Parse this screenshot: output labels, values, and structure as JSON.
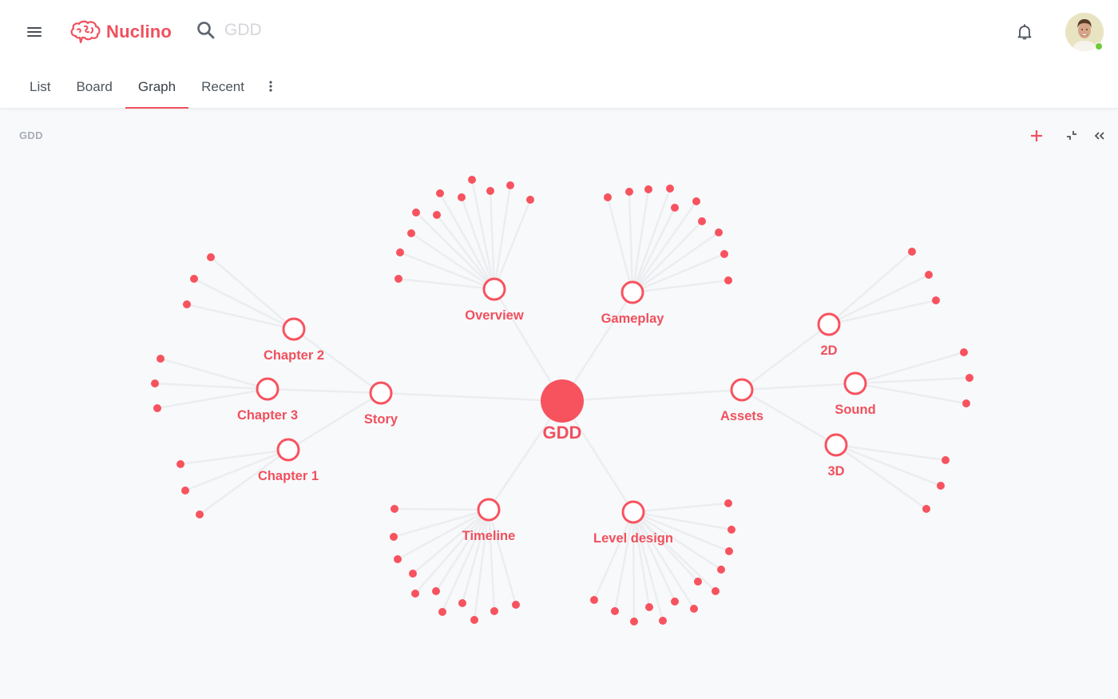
{
  "app": {
    "name": "Nuclino",
    "brand_color": "#f0505d"
  },
  "header": {
    "menu_icon": "hamburger-icon",
    "search_icon": "search-icon",
    "search_value": "GDD",
    "notifications_icon": "bell-icon",
    "user_status": "online"
  },
  "tabs": [
    {
      "label": "List",
      "active": false
    },
    {
      "label": "Board",
      "active": false
    },
    {
      "label": "Graph",
      "active": true
    },
    {
      "label": "Recent",
      "active": false
    }
  ],
  "tabs_more_icon": "vertical-dots-icon",
  "breadcrumb": "GDD",
  "toolbar": {
    "add_icon": "plus-icon",
    "collapse_icon": "minimize-icon",
    "sidebar_icon": "double-chevron-left-icon"
  },
  "graph": {
    "colors": {
      "node": "#f7535f",
      "edge": "#ebedf0"
    },
    "root": {
      "label": "GDD"
    },
    "nodes": [
      {
        "id": "overview",
        "label": "Overview",
        "parent": "root",
        "leaves": 13
      },
      {
        "id": "gameplay",
        "label": "Gameplay",
        "parent": "root",
        "leaves": 12
      },
      {
        "id": "story",
        "label": "Story",
        "parent": "root",
        "leaves": 0
      },
      {
        "id": "chapter2",
        "label": "Chapter 2",
        "parent": "story",
        "leaves": 3
      },
      {
        "id": "chapter3",
        "label": "Chapter 3",
        "parent": "story",
        "leaves": 3
      },
      {
        "id": "chapter1",
        "label": "Chapter 1",
        "parent": "story",
        "leaves": 3
      },
      {
        "id": "assets",
        "label": "Assets",
        "parent": "root",
        "leaves": 0
      },
      {
        "id": "2d",
        "label": "2D",
        "parent": "assets",
        "leaves": 3
      },
      {
        "id": "sound",
        "label": "Sound",
        "parent": "assets",
        "leaves": 3
      },
      {
        "id": "3d",
        "label": "3D",
        "parent": "assets",
        "leaves": 3
      },
      {
        "id": "timeline",
        "label": "Timeline",
        "parent": "root",
        "leaves": 12
      },
      {
        "id": "leveldesign",
        "label": "Level design",
        "parent": "root",
        "leaves": 14
      }
    ]
  }
}
